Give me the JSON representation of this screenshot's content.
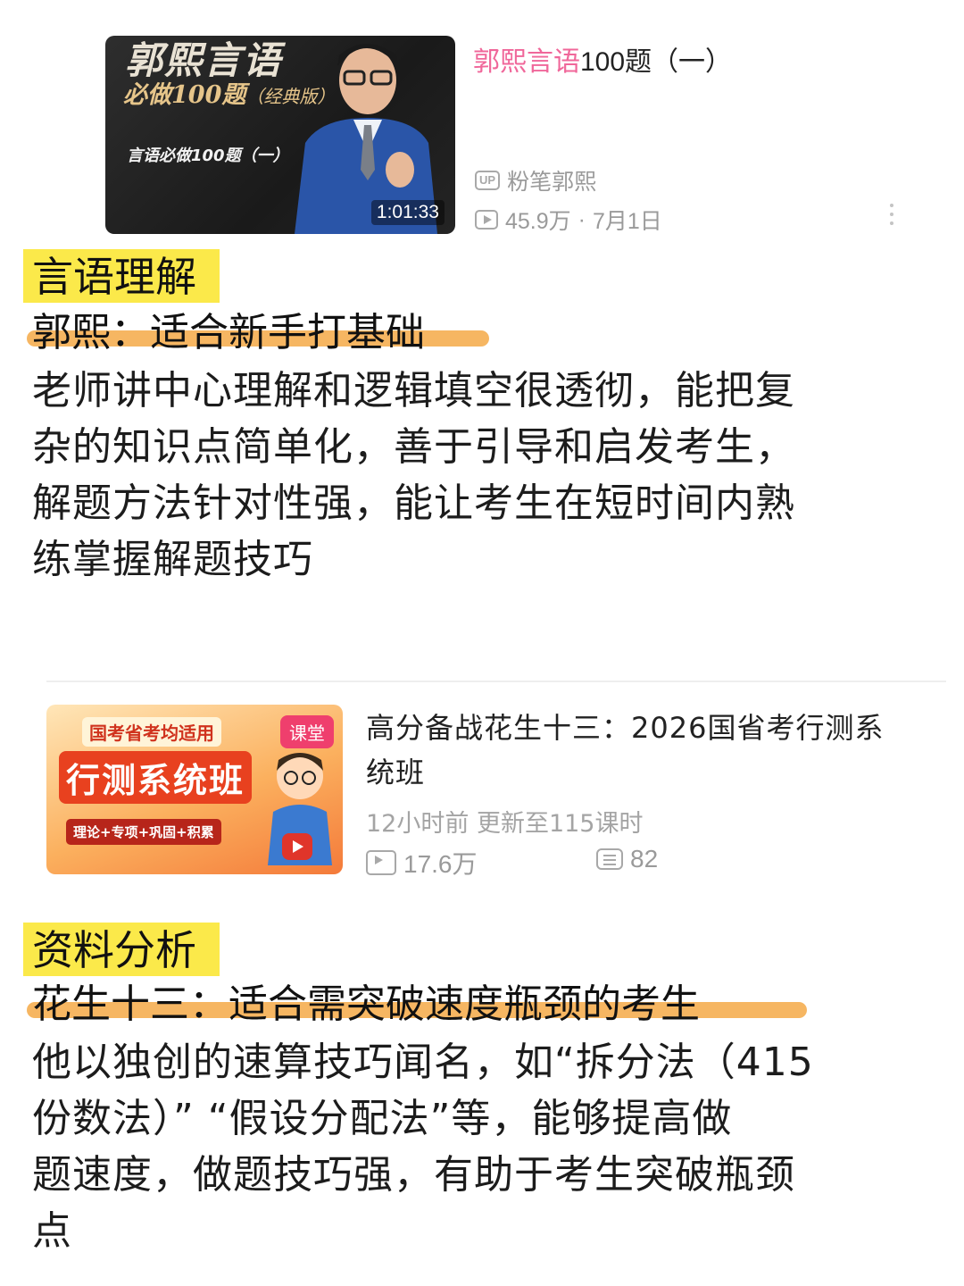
{
  "video1": {
    "thumbnail": {
      "line1": "郭熙言语",
      "line2": "必做100题",
      "line2_suffix": "（经典版）",
      "line3": "言语必做100题（一）",
      "duration": "1:01:33"
    },
    "title_highlight": "郭熙言语",
    "title_rest": "100题（一）",
    "uploader_badge": "UP",
    "uploader": "粉笔郭熙",
    "views": "45.9万",
    "separator": "·",
    "date": "7月1日"
  },
  "section1": {
    "tag": "言语理解",
    "heading": "郭熙：适合新手打基础",
    "body_lines": [
      "老师讲中心理解和逻辑填空很透彻，能把复",
      "杂的知识点简单化，善于引导和启发考生，",
      "解题方法针对性强，能让考生在短时间内熟",
      "练掌握解题技巧"
    ]
  },
  "video2": {
    "thumbnail": {
      "banner_top": "国考省考均适用",
      "banner_big": "行测系统班",
      "banner_sub": "理论+专项+巩固+积累",
      "course_tag": "课堂"
    },
    "title_lines": [
      "高分备战花生十三：2026国省考行测系",
      "统班"
    ],
    "update": "12小时前 更新至115课时",
    "views": "17.6万",
    "lessons": "82"
  },
  "section2": {
    "tag": "资料分析",
    "heading": "花生十三：适合需突破速度瓶颈的考生",
    "body_lines": [
      "他以独创的速算技巧闻名，如“拆分法（415",
      "份数法）” “假设分配法”等，能够提高做",
      "题速度，做题技巧强，有助于考生突破瓶颈",
      "点"
    ]
  },
  "colors": {
    "title_highlight": "#f0679a",
    "tag_background": "#fbe94a",
    "underline": "#f5b25a",
    "meta_gray": "#9a9a9a"
  }
}
